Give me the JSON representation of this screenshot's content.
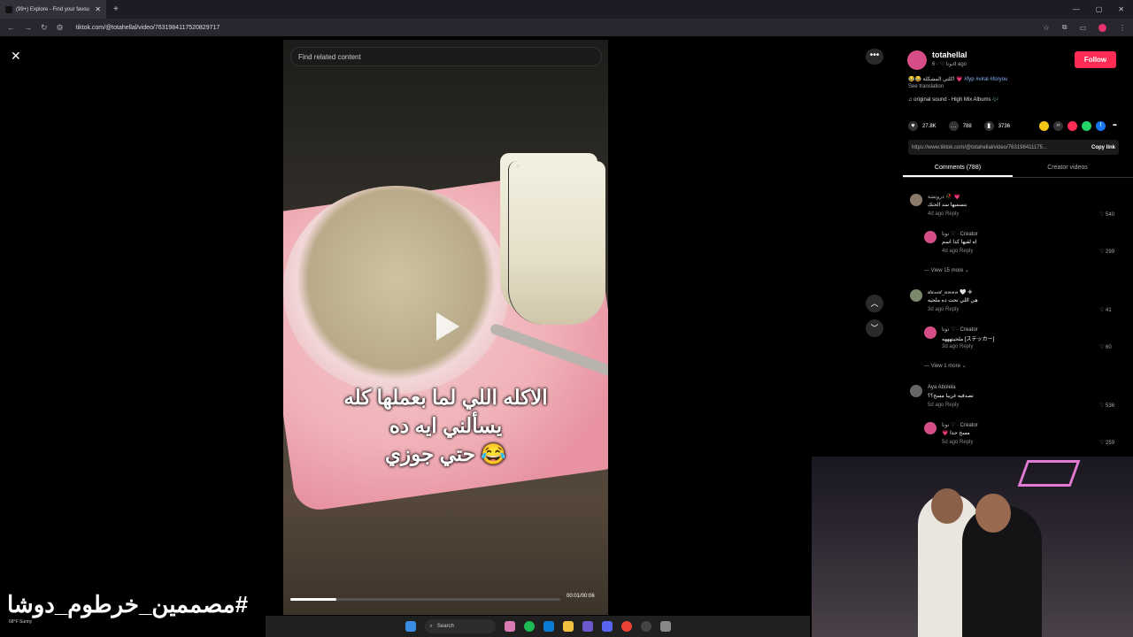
{
  "browser": {
    "tab_title": "(99+) Explore - Find your favou",
    "tab_close": "✕",
    "new_tab": "+",
    "url": "tiktok.com/@totahellal/video/7631984117520829717"
  },
  "overlay": {
    "close": "✕",
    "search_placeholder": "Find related content",
    "more": "•••"
  },
  "video": {
    "caption_line1": "الاكله اللي لما بعملها كله",
    "caption_line2": "يسألني ايه ده",
    "caption_line3": "حتي جوزي 😂",
    "time": "00:01/00:06",
    "progress_fraction": 0.17
  },
  "post": {
    "author": "totahellal",
    "author_sub": "توتا ♡ · 6d ago",
    "follow_label": "Follow",
    "description": "😂😂 اكلتي المشكلة 💗",
    "hashtags": "#fyp #viral #foryou",
    "see_translation": "See translation",
    "music": "♫ original sound - High Mix Albums 🎶",
    "likes": "27.8K",
    "comments_count": "788",
    "saves": "3736",
    "link": "https://www.tiktok.com/@totahellal/video/763198411175...",
    "copy_link": "Copy link"
  },
  "tabs": {
    "comments": "Comments (788)",
    "creator_videos": "Creator videos"
  },
  "comments": [
    {
      "name": "درويشة 🥀 💗",
      "text": "بتسميها سد الحنك",
      "meta": "4d ago   Reply",
      "likes": "♡ 540"
    },
    {
      "name": "توتا ♡ · Creator",
      "text": "اه لقيها كدا اسم",
      "meta": "4d ago   Reply",
      "likes": "♡ 299"
    },
    {
      "name": "𝓭𝓪𝓿𝓲𝓭_𝓪𝓷𝓷𝓷 🤍 ✚",
      "text": "هي اللي تحت ده ملحيه",
      "meta": "3d ago   Reply",
      "likes": "♡ 41"
    },
    {
      "name": "توتا ♡ · Creator",
      "text": "ملحيتهههه [ステッカー]",
      "meta": "3d ago   Reply",
      "likes": "♡ 60"
    },
    {
      "name": "Aya Abolela",
      "text": "تصدقيه غريبا مسح؟؟",
      "meta": "5d ago   Reply",
      "likes": "♡ 536"
    },
    {
      "name": "توتا ♡ · Creator",
      "text": "💗 مسح جدا",
      "meta": "5d ago   Reply",
      "likes": "♡ 259"
    }
  ],
  "view_more_1": "— View 15 more ⌄",
  "view_more_2": "— View 1 more ⌄",
  "watermark": "#مصممين_خرطوم_دوشا",
  "weather": "68°F Sunny",
  "taskbar": {
    "search": "Search"
  },
  "colors": {
    "accent": "#fe2c55",
    "hashtag": "#8ab4f8"
  }
}
